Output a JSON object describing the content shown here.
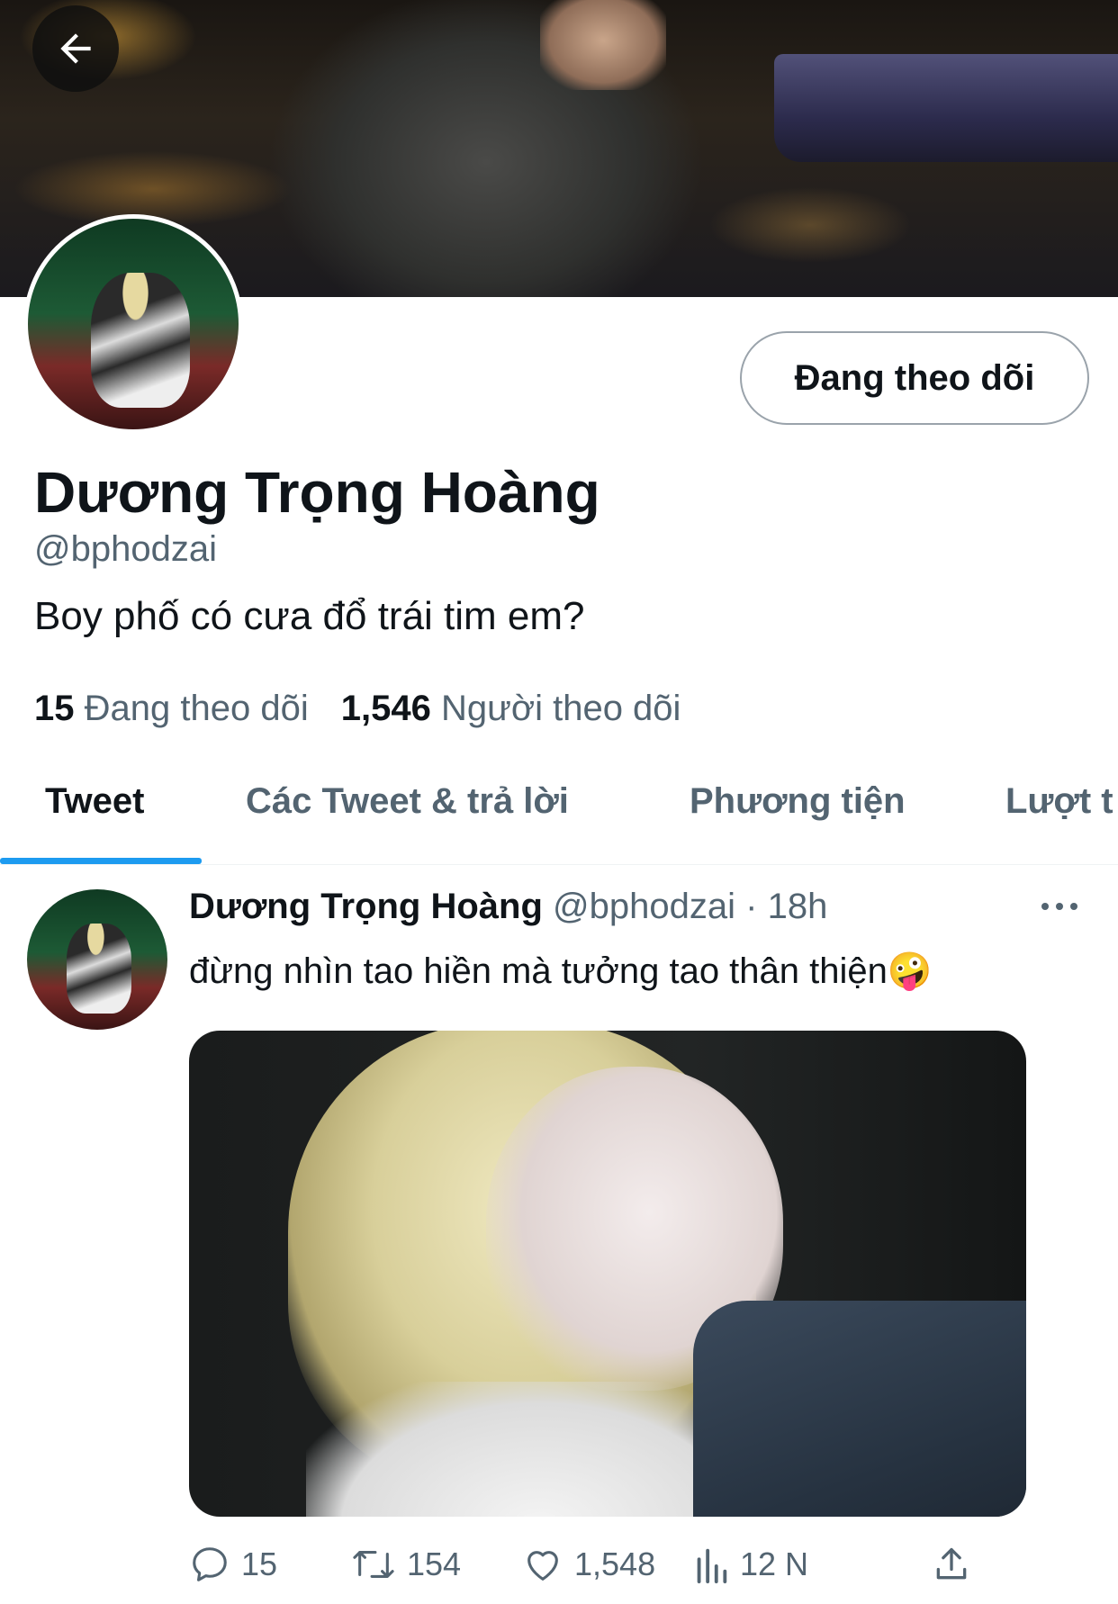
{
  "header": {
    "back_icon": "arrow-left-icon"
  },
  "profile": {
    "name": "Dương Trọng Hoàng",
    "handle": "@bphodzai",
    "bio": "Boy phố có cưa đổ trái tim em?",
    "follow_button_label": "Đang theo dõi",
    "following_count": "15",
    "following_label": "Đang theo dõi",
    "followers_count": "1,546",
    "followers_label": "Người theo dõi"
  },
  "tabs": [
    {
      "label": "Tweet",
      "active": true
    },
    {
      "label": "Các Tweet & trả lời",
      "active": false
    },
    {
      "label": "Phương tiện",
      "active": false
    },
    {
      "label": "Lượt t",
      "active": false
    }
  ],
  "tweet": {
    "author_name": "Dương Trọng Hoàng",
    "author_handle": "@bphodzai",
    "separator": "·",
    "time": "18h",
    "text": "đừng nhìn tao hiền mà tưởng tao thân thiện",
    "emoji": "🤪",
    "replies": "15",
    "retweets": "154",
    "likes": "1,548",
    "views": "12 N"
  },
  "colors": {
    "accent": "#1d9bf0",
    "text": "#0f1419",
    "muted": "#536471"
  }
}
